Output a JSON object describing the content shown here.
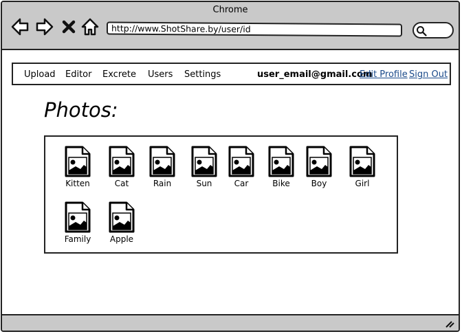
{
  "window": {
    "title": "Chrome"
  },
  "toolbar": {
    "url": "http://www.ShotShare.by/user/id",
    "icons": [
      "back-arrow-icon",
      "forward-arrow-icon",
      "close-icon",
      "home-icon",
      "search-icon"
    ]
  },
  "navbar": {
    "items": [
      {
        "label": "Upload"
      },
      {
        "label": "Editor"
      },
      {
        "label": "Excrete"
      },
      {
        "label": "Users"
      },
      {
        "label": "Settings"
      }
    ],
    "user_email": "user_email@gmail.com",
    "edit_profile": "Edit Profile",
    "sign_out": "Sign Out",
    "link_color": "#1a4a8a"
  },
  "page": {
    "title": "Photos:"
  },
  "photos": [
    {
      "label": "Kitten"
    },
    {
      "label": "Cat"
    },
    {
      "label": "Rain"
    },
    {
      "label": "Sun"
    },
    {
      "label": "Car"
    },
    {
      "label": "Bike"
    },
    {
      "label": "Boy"
    },
    {
      "label": "Girl"
    },
    {
      "label": "Family"
    },
    {
      "label": "Apple"
    }
  ],
  "colors": {
    "chrome": "#c9c9c9",
    "border": "#222222"
  }
}
